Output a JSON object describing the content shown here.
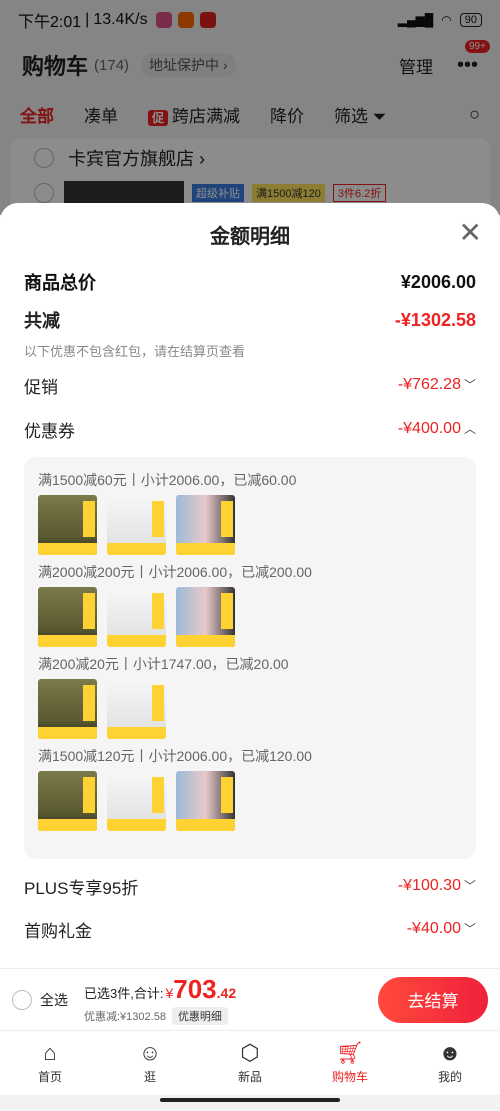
{
  "status_bar": {
    "time": "下午2:01",
    "net_speed": "13.4K/s",
    "battery": "90",
    "app_icons": [
      "app-icon-pink",
      "taobao-icon",
      "app-icon-red"
    ]
  },
  "header": {
    "title": "购物车",
    "count": "(174)",
    "address": "地址保护中 ›",
    "manage": "管理",
    "badge": "99+"
  },
  "tabs": {
    "all": "全部",
    "combine": "凑单",
    "cu": "促",
    "cross_store": "跨店满减",
    "price_drop": "降价",
    "filter": "筛选"
  },
  "store": {
    "name": "卡宾官方旗舰店 ›",
    "tag1": "超级补贴",
    "tag2": "满1500减120",
    "tag3": "3件6.2折"
  },
  "sheet": {
    "title": "金额明细",
    "total_label": "商品总价",
    "total_value": "¥2006.00",
    "discount_label": "共减",
    "discount_value": "-¥1302.58",
    "note": "以下优惠不包含红包，请在结算页查看",
    "promo_label": "促销",
    "promo_value": "-¥762.28",
    "coupon_label": "优惠券",
    "coupon_value": "-¥400.00",
    "coupon_groups": [
      {
        "title": "满1500减60元丨小计2006.00，已减60.00",
        "items": [
          "olive",
          "white",
          "couple"
        ]
      },
      {
        "title": "满2000减200元丨小计2006.00，已减200.00",
        "items": [
          "olive",
          "white",
          "couple"
        ]
      },
      {
        "title": "满200减20元丨小计1747.00，已减20.00",
        "items": [
          "olive",
          "white"
        ]
      },
      {
        "title": "满1500减120元丨小计2006.00，已减120.00",
        "items": [
          "olive",
          "white",
          "couple"
        ]
      }
    ],
    "plus_label": "PLUS专享95折",
    "plus_value": "-¥100.30",
    "gift_label": "首购礼金",
    "gift_value": "-¥40.00"
  },
  "checkout": {
    "select_all": "全选",
    "selected": "已选3件,合计:",
    "yen": "¥",
    "price_int": "703",
    "price_dec": ".42",
    "saved": "优惠减:¥1302.58",
    "detail": "优惠明细",
    "go": "去结算"
  },
  "tabbar": {
    "home": "首页",
    "browse": "逛",
    "new": "新品",
    "cart": "购物车",
    "mine": "我的"
  },
  "colors": {
    "accent": "#e22222",
    "coupon_bg": "#f5f5f5"
  }
}
